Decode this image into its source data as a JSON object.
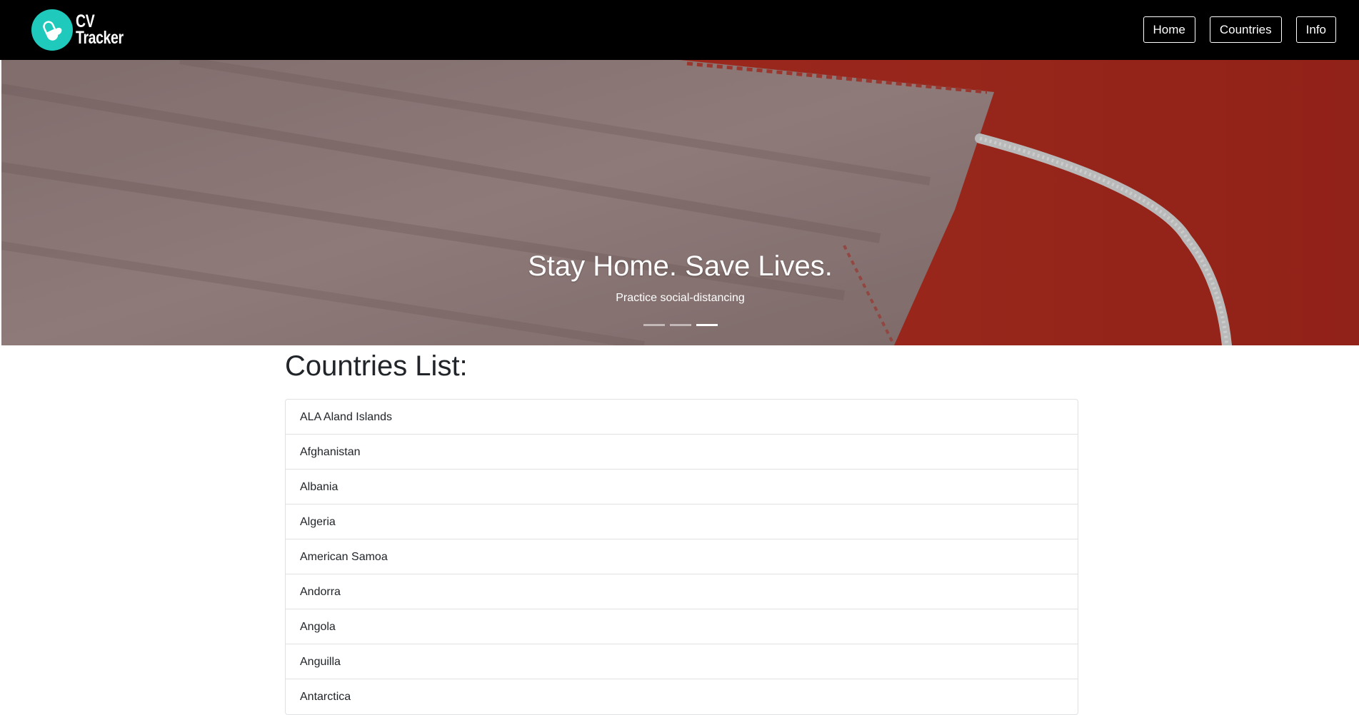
{
  "brand": {
    "line1": "CV",
    "line2": "Tracker",
    "logo_icon": "capsule-pill-icon",
    "logo_color": "#1fc9bb"
  },
  "nav": {
    "items": [
      {
        "label": "Home"
      },
      {
        "label": "Countries"
      },
      {
        "label": "Info"
      }
    ]
  },
  "hero": {
    "title": "Stay Home. Save Lives.",
    "subtitle": "Practice social-distancing",
    "slide_count": 3,
    "active_slide": 3,
    "background_color": "#b2271c"
  },
  "main": {
    "title": "Countries List:",
    "countries": [
      "ALA Aland Islands",
      "Afghanistan",
      "Albania",
      "Algeria",
      "American Samoa",
      "Andorra",
      "Angola",
      "Anguilla",
      "Antarctica"
    ]
  }
}
